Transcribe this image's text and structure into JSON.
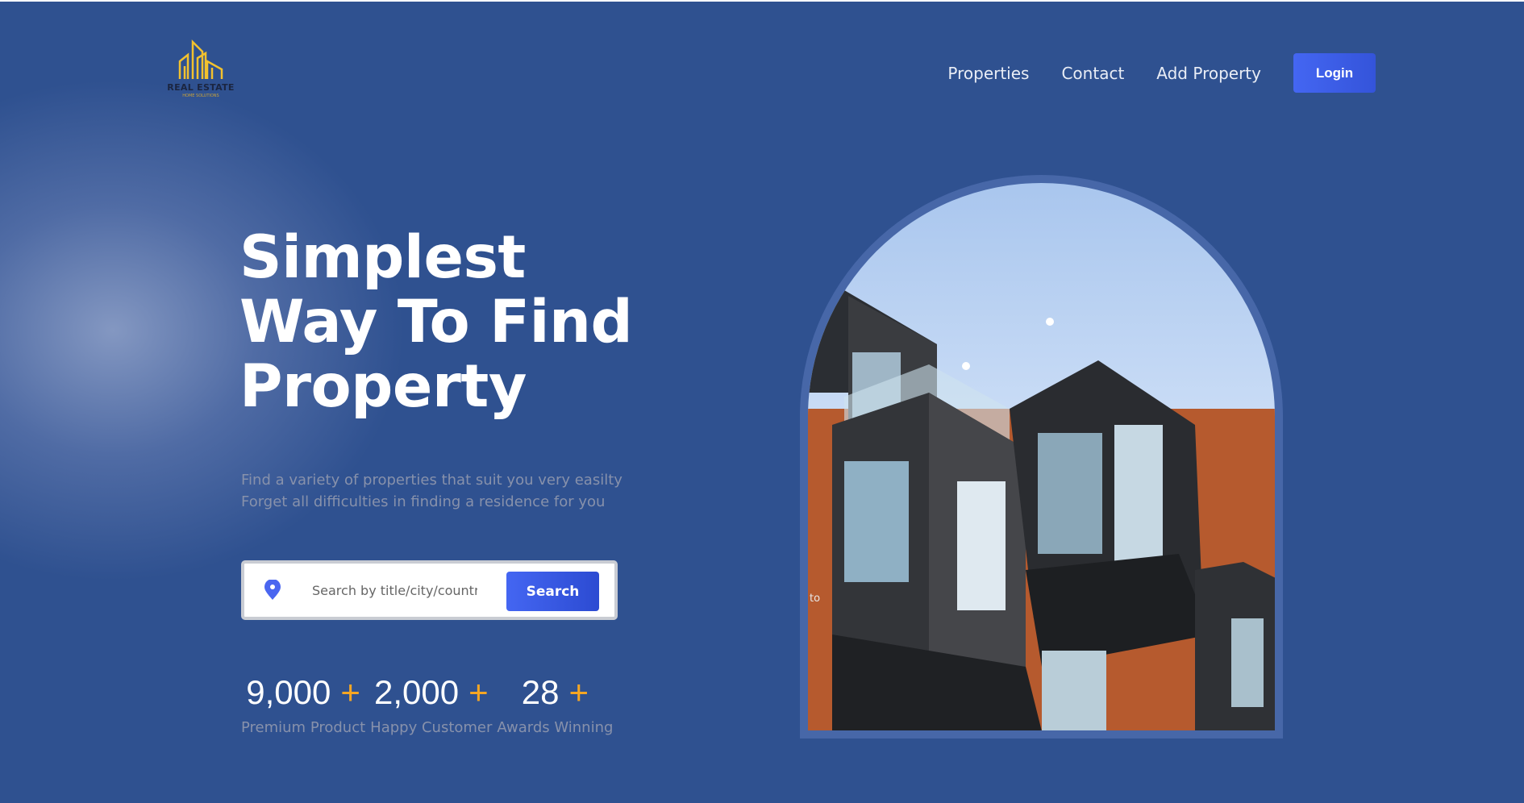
{
  "brand": {
    "title": "REAL ESTATE",
    "subtitle": "HOME SOLUTIONS",
    "color": "#f2c12e"
  },
  "nav": {
    "items": [
      "Properties",
      "Contact",
      "Add Property"
    ],
    "login": "Login"
  },
  "hero": {
    "title_lines": [
      "Simplest",
      "Way To Find",
      "Property"
    ],
    "subtitle_lines": [
      "Find a variety of properties that suit you very easilty",
      "Forget all difficulties in finding a residence for you"
    ]
  },
  "search": {
    "placeholder": "Search by title/city/country",
    "button": "Search",
    "icon": "map-pin-icon"
  },
  "stats": [
    {
      "value": "9,000",
      "plus": "+",
      "label": "Premium Product"
    },
    {
      "value": "2,000",
      "plus": "+",
      "label": "Happy Customer"
    },
    {
      "value": "28",
      "plus": "+",
      "label": "Awards Winning"
    }
  ],
  "image": {
    "stray_text": "to"
  },
  "colors": {
    "background": "#2f5190",
    "accent": "#3f5ff0",
    "plus": "#f5a623"
  }
}
